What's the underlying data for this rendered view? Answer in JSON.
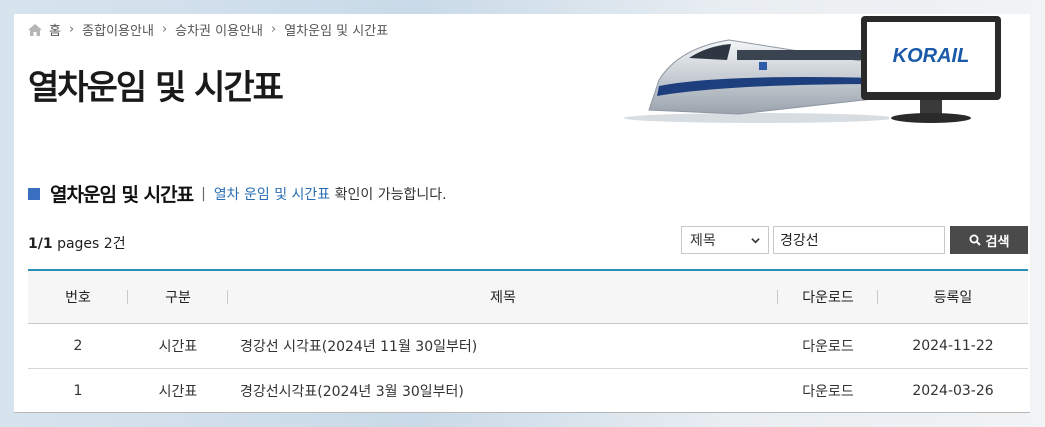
{
  "breadcrumb": [
    "홈",
    "종합이용안내",
    "승차권 이용안내",
    "열차운임 및 시간표"
  ],
  "page_title": "열차운임 및 시간표",
  "banner": {
    "logo_text": "KORAIL"
  },
  "section": {
    "title": "열차운임 및 시간표",
    "desc_link": "열차 운임 및 시간표",
    "desc_rest": " 확인이 가능합니다."
  },
  "pages_info": {
    "current": "1/1",
    "label": "pages",
    "count": "2건"
  },
  "search": {
    "select_value": "제목",
    "input_value": "경강선",
    "button_label": "검색"
  },
  "table": {
    "headers": [
      "번호",
      "구분",
      "제목",
      "다운로드",
      "등록일"
    ],
    "rows": [
      {
        "no": "2",
        "category": "시간표",
        "title": "경강선 시각표(2024년 11월 30일부터)",
        "download": "다운로드",
        "date": "2024-11-22"
      },
      {
        "no": "1",
        "category": "시간표",
        "title": "경강선시각표(2024년 3월 30일부터)",
        "download": "다운로드",
        "date": "2024-03-26"
      }
    ]
  },
  "colors": {
    "accent_line": "#2a8fb6",
    "section_square": "#3a6fc0",
    "link": "#2a6fb5",
    "button": "#4a4a4a",
    "logo": "#1a5aa8"
  }
}
